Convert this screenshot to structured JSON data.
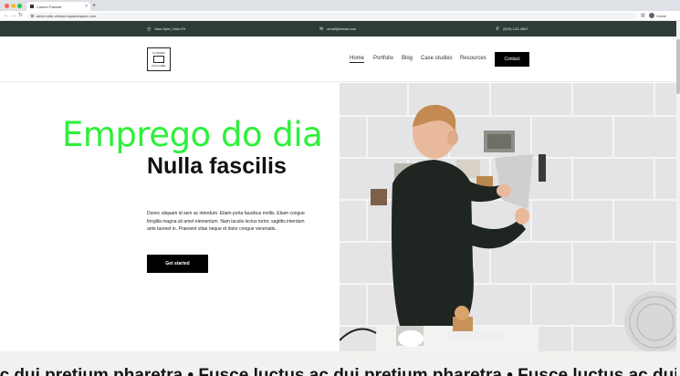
{
  "browser": {
    "tab_title": "Cusurn Faclure",
    "tab_close": "×",
    "new_tab": "+",
    "url": "seven-site-version.squarespace.com",
    "guest_label": "Guest",
    "back": "←",
    "forward": "→",
    "reload": "↻"
  },
  "infobar": {
    "hours": "9am-5pm | Mon-Fri",
    "email": "email@email.com",
    "phone": "(619) 123-4567"
  },
  "header": {
    "logo_top": "CUSURN",
    "logo_bottom": "FACLURE",
    "nav": [
      "Home",
      "Portfolio",
      "Blog",
      "Case studies",
      "Resources"
    ],
    "contact_label": "Contact"
  },
  "hero": {
    "overlay": "Emprego do dia",
    "title": "Nulla fascilis",
    "body": "Donec aliquam id sem ac interdum. Etiam porta faucibus mollis. Etiam congue fringilla magna sit amet elementum. Nam iaculis lectus tortor, sagittis interdum ante laoreet in. Praesent vitae neque et dolor congue venenatis.",
    "cta_label": "Get started"
  },
  "marquee": {
    "text": "ac dui pretium pharetra  •  Fusce luctus ac dui pretium pharetra  •  Fusce luctus ac dui pretium pharetra  •  Fusce luctus ac dui"
  },
  "colors": {
    "infobar_bg": "#2e3b38",
    "overlay_green": "#2ef03a",
    "button_bg": "#000000",
    "marquee_bg": "#f1f2ef"
  },
  "icons": [
    "clock-icon",
    "mail-icon",
    "phone-icon",
    "lock-icon",
    "user-avatar-icon"
  ]
}
